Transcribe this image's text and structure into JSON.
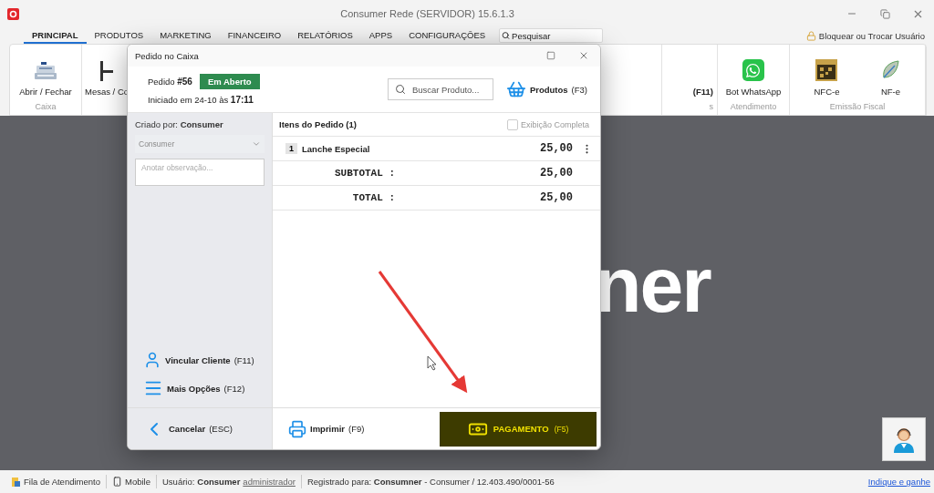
{
  "window": {
    "title": "Consumer Rede (SERVIDOR) 15.6.1.3"
  },
  "menu_tabs": [
    {
      "label": "PRINCIPAL",
      "selected": true
    },
    {
      "label": "PRODUTOS",
      "selected": false
    },
    {
      "label": "MARKETING",
      "selected": false
    },
    {
      "label": "FINANCEIRO",
      "selected": false
    },
    {
      "label": "RELATÓRIOS",
      "selected": false
    },
    {
      "label": "APPS",
      "selected": false
    },
    {
      "label": "CONFIGURAÇÕES",
      "selected": false
    }
  ],
  "search": {
    "placeholder": "Pesquisar"
  },
  "user_action": "Bloquear ou Trocar Usuário",
  "ribbon": {
    "groups": [
      {
        "kind": "full",
        "label": "Caixa",
        "items": [
          {
            "kind": "register",
            "label": "Abrir / Fechar"
          }
        ]
      },
      {
        "kind": "left",
        "items": [
          {
            "kind": "tables",
            "label": "Mesas / Co"
          }
        ]
      },
      {
        "kind": "right",
        "label": "s",
        "items": [
          {
            "kind": "text",
            "label": "(F11)"
          }
        ]
      },
      {
        "kind": "full",
        "label": "Atendimento",
        "items": [
          {
            "kind": "whatsapp",
            "label": "Bot WhatsApp"
          }
        ]
      },
      {
        "kind": "full",
        "label": "Emissão Fiscal",
        "items": [
          {
            "kind": "nfce",
            "label": "NFC-e"
          },
          {
            "kind": "nfe",
            "label": "NF-e"
          }
        ]
      }
    ]
  },
  "background_text": "ner",
  "dialog": {
    "title": "Pedido no Caixa",
    "order": "Pedido **#56**",
    "status": "Em Aberto",
    "started": "Iniciado em 24-10 às **17:11**",
    "product_search": {
      "placeholder": "Buscar Produto..."
    },
    "products_button": {
      "label": "Produtos",
      "key": "(F3)"
    },
    "created_by": "Criado por: **Consumer**",
    "creator_select": {
      "value": "Consumer",
      "disabled": true
    },
    "note": {
      "placeholder": "Anotar observação..."
    },
    "options": [
      {
        "kind": "client",
        "label": "Vincular Cliente",
        "key": "(F11)"
      },
      {
        "kind": "more",
        "label": "Mais Opções",
        "key": "(F12)"
      }
    ],
    "cancel": {
      "label": "Cancelar",
      "key": "(ESC)"
    },
    "items_title": "Itens do Pedido (1)",
    "full_view": {
      "label": "Exibição Completa",
      "checked": false
    },
    "items": [
      {
        "qty": "1",
        "name": "Lanche Especial",
        "price": "25,00"
      }
    ],
    "totals": [
      {
        "label": "SUBTOTAL :",
        "value": "25,00"
      },
      {
        "label": "TOTAL :",
        "value": "25,00"
      }
    ],
    "print": {
      "label": "Imprimir",
      "key": "(F9)"
    },
    "pay": {
      "label": "PAGAMENTO",
      "key": "(F5)"
    }
  },
  "status_bar": {
    "queue": "Fila de Atendimento",
    "mobile": "Mobile",
    "user_label": "Usuário:",
    "user": "Consumer",
    "role": "administrador",
    "registered": "Registrado para: **Consumner** - Consumer / 12.403.490/0001-56",
    "invite": "Indique e ganhe"
  }
}
